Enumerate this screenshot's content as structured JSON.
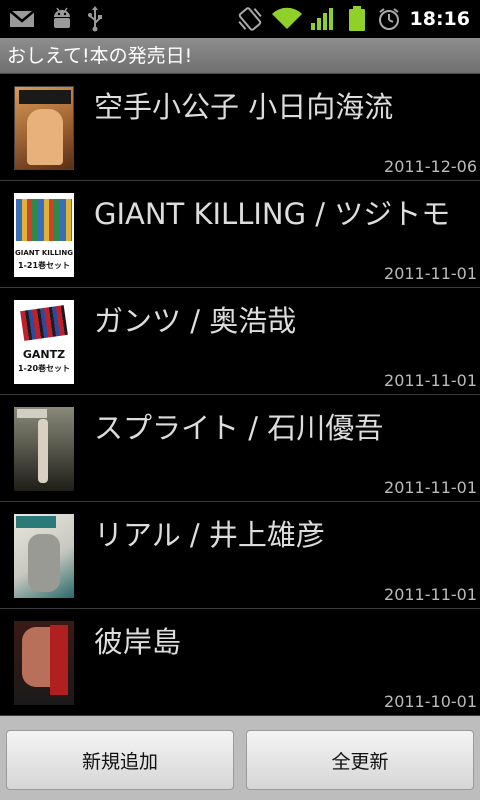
{
  "statusbar": {
    "time": "18:16",
    "left_icons": [
      "gmail-icon",
      "android-debug-icon",
      "usb-icon"
    ],
    "right_icons": [
      "vibrate-icon",
      "wifi-icon",
      "signal-icon",
      "battery-icon",
      "alarm-icon"
    ]
  },
  "app": {
    "title": "おしえて!本の発売日!"
  },
  "books": [
    {
      "title": "空手小公子 小日向海流",
      "date": "2011-12-06",
      "cover_icon": "karate-manga-cover-icon",
      "cover_colors": [
        "#c98a4a",
        "#6b3a1c"
      ]
    },
    {
      "title": "GIANT KILLING / ツジトモ",
      "date": "2011-11-01",
      "cover_icon": "giant-killing-box-set-cover-icon",
      "cover_text": [
        "GIANT KILLING",
        "1-21巻セット"
      ],
      "cover_colors": [
        "#3a6fb5",
        "#e0b23a"
      ]
    },
    {
      "title": "ガンツ / 奥浩哉",
      "date": "2011-11-01",
      "cover_icon": "gantz-box-set-cover-icon",
      "cover_text": [
        "GANTZ",
        "1-20巻セット"
      ],
      "cover_colors": [
        "#c0202a",
        "#222222"
      ]
    },
    {
      "title": "スプライト / 石川優吾",
      "date": "2011-11-01",
      "cover_icon": "sprite-manga-cover-icon",
      "cover_colors": [
        "#7a7a6a",
        "#2a2a22"
      ]
    },
    {
      "title": "リアル / 井上雄彦",
      "date": "2011-11-01",
      "cover_icon": "real-manga-cover-icon",
      "cover_colors": [
        "#d8d8d0",
        "#2a6a6a"
      ]
    },
    {
      "title": "彼岸島",
      "date": "2011-10-01",
      "cover_icon": "higanjima-manga-cover-icon",
      "cover_colors": [
        "#b02020",
        "#1a1a1a"
      ]
    }
  ],
  "buttons": {
    "add_label": "新規追加",
    "refresh_label": "全更新"
  }
}
